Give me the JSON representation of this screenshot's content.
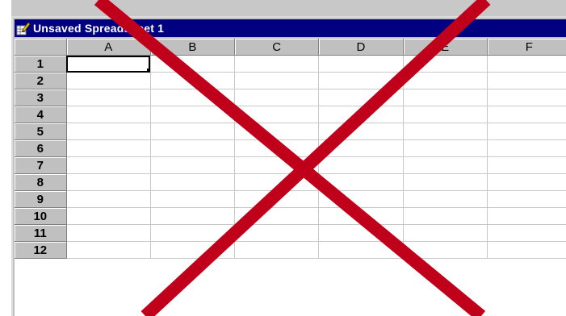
{
  "window": {
    "title": "Unsaved Spreadsheet 1"
  },
  "sheet": {
    "columns": [
      "A",
      "B",
      "C",
      "D",
      "E",
      "F"
    ],
    "rows": [
      "1",
      "2",
      "3",
      "4",
      "5",
      "6",
      "7",
      "8",
      "9",
      "10",
      "11",
      "12"
    ],
    "active_cell": "A1"
  },
  "icons": {
    "app": "spreadsheet-pencil-icon",
    "overlay": "red-x-mark"
  },
  "colors": {
    "title_bar": "#000080",
    "title_text": "#ffffff",
    "header_bg": "#c0c0c0",
    "strike": "#c0001a"
  }
}
